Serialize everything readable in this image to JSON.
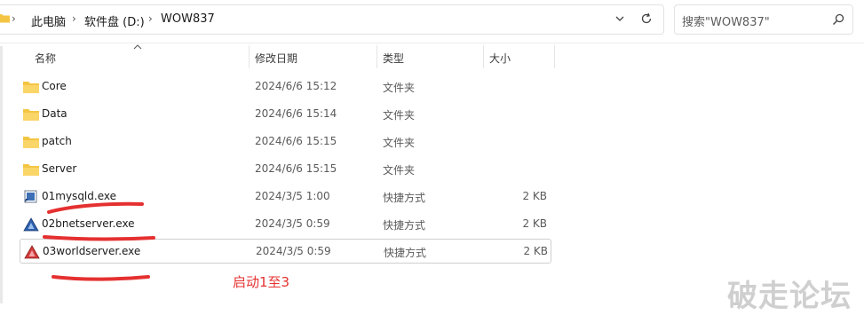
{
  "address_bar": {
    "crumbs": [
      "此电脑",
      "软件盘 (D:)",
      "WOW837"
    ]
  },
  "search": {
    "placeholder": "搜索\"WOW837\""
  },
  "columns": {
    "name": "名称",
    "date": "修改日期",
    "type": "类型",
    "size": "大小"
  },
  "files": [
    {
      "name": "Core",
      "date": "2024/6/6 15:12",
      "type": "文件夹",
      "size": "",
      "icon": "folder-icon"
    },
    {
      "name": "Data",
      "date": "2024/6/6 15:14",
      "type": "文件夹",
      "size": "",
      "icon": "folder-icon"
    },
    {
      "name": "patch",
      "date": "2024/6/6 15:15",
      "type": "文件夹",
      "size": "",
      "icon": "folder-icon"
    },
    {
      "name": "Server",
      "date": "2024/6/6 15:15",
      "type": "文件夹",
      "size": "",
      "icon": "folder-icon"
    },
    {
      "name": "01mysqld.exe",
      "date": "2024/3/5 1:00",
      "type": "快捷方式",
      "size": "2 KB",
      "icon": "exe-shortcut-icon"
    },
    {
      "name": "02bnetserver.exe",
      "date": "2024/3/5 0:59",
      "type": "快捷方式",
      "size": "2 KB",
      "icon": "triangle-app-icon"
    },
    {
      "name": "03worldserver.exe",
      "date": "2024/3/5 0:59",
      "type": "快捷方式",
      "size": "2 KB",
      "icon": "triangle-app-red-icon"
    }
  ],
  "annotation": "启动1至3",
  "watermark": "破走论坛",
  "colors": {
    "folder": "#f4c542",
    "annotation_red": "#e53030",
    "selection_border": "#cfcfcf"
  }
}
